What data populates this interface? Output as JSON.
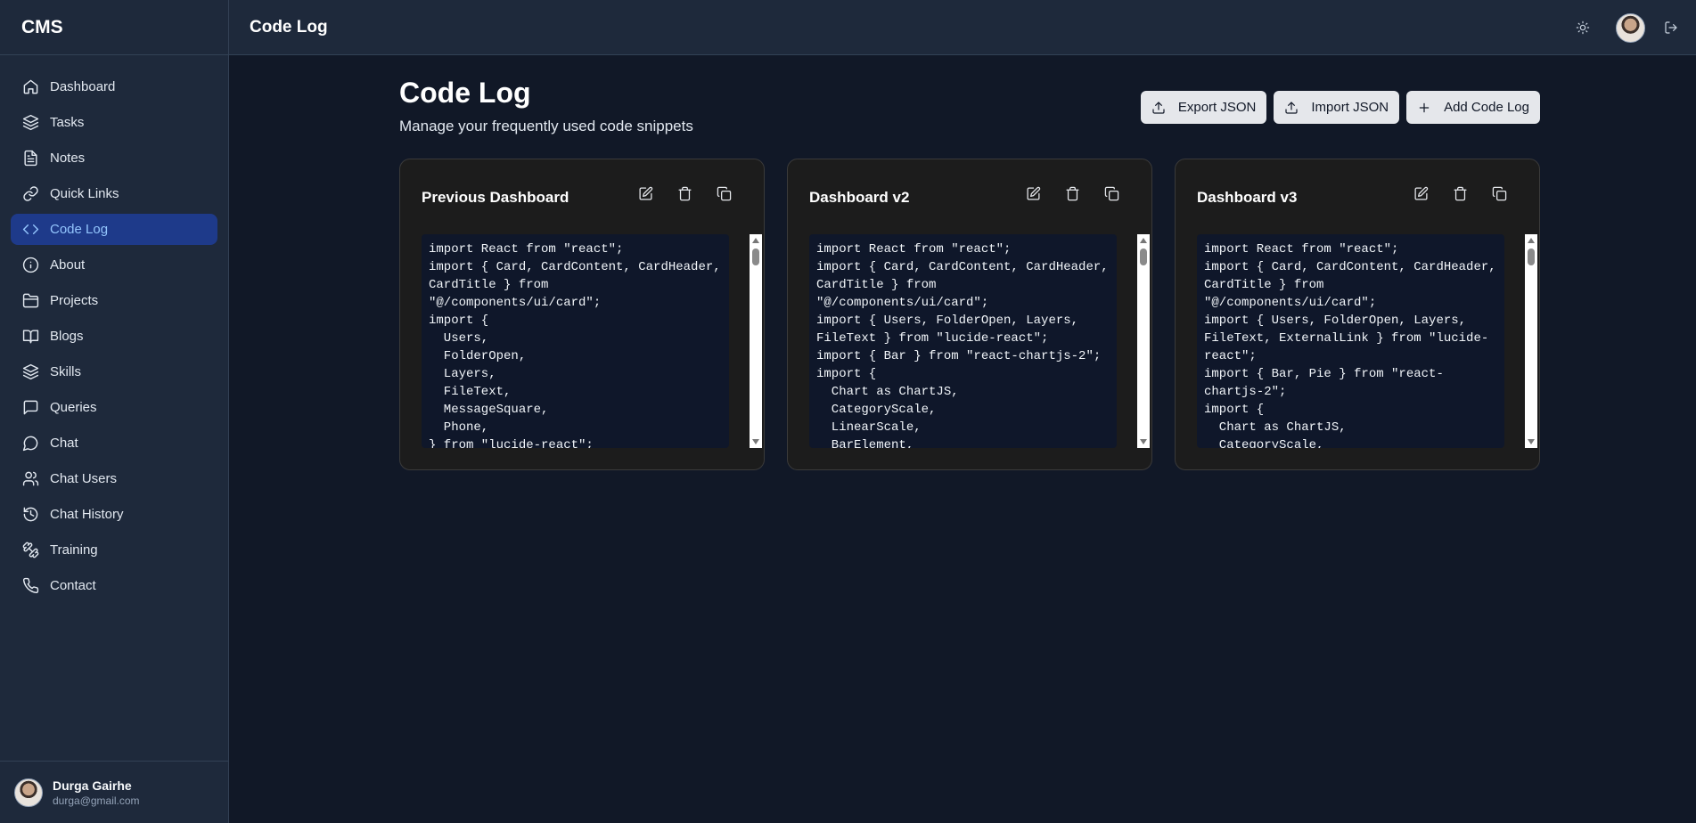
{
  "app": {
    "brand": "CMS"
  },
  "header": {
    "title": "Code Log"
  },
  "sidebar": {
    "items": [
      {
        "label": "Dashboard",
        "icon": "home-icon",
        "active": false
      },
      {
        "label": "Tasks",
        "icon": "layers-icon",
        "active": false
      },
      {
        "label": "Notes",
        "icon": "file-text-icon",
        "active": false
      },
      {
        "label": "Quick Links",
        "icon": "link-icon",
        "active": false
      },
      {
        "label": "Code Log",
        "icon": "code-icon",
        "active": true
      },
      {
        "label": "About",
        "icon": "info-icon",
        "active": false
      },
      {
        "label": "Projects",
        "icon": "folder-icon",
        "active": false
      },
      {
        "label": "Blogs",
        "icon": "book-open-icon",
        "active": false
      },
      {
        "label": "Skills",
        "icon": "layers-icon",
        "active": false
      },
      {
        "label": "Queries",
        "icon": "message-square-icon",
        "active": false
      },
      {
        "label": "Chat",
        "icon": "message-circle-icon",
        "active": false
      },
      {
        "label": "Chat Users",
        "icon": "users-icon",
        "active": false
      },
      {
        "label": "Chat History",
        "icon": "history-icon",
        "active": false
      },
      {
        "label": "Training",
        "icon": "dumbbell-icon",
        "active": false
      },
      {
        "label": "Contact",
        "icon": "phone-icon",
        "active": false
      }
    ],
    "user": {
      "name": "Durga Gairhe",
      "email": "durga@gmail.com"
    }
  },
  "main": {
    "title": "Code Log",
    "subtitle": "Manage your frequently used code snippets",
    "actions": {
      "export_label": "Export JSON",
      "import_label": "Import JSON",
      "add_label": "Add Code Log"
    },
    "cards": [
      {
        "title": "Previous Dashboard",
        "code": "import React from \"react\";\nimport { Card, CardContent, CardHeader,\nCardTitle } from\n\"@/components/ui/card\";\nimport {\n  Users,\n  FolderOpen,\n  Layers,\n  FileText,\n  MessageSquare,\n  Phone,\n} from \"lucide-react\";"
      },
      {
        "title": "Dashboard v2",
        "code": "import React from \"react\";\nimport { Card, CardContent, CardHeader,\nCardTitle } from\n\"@/components/ui/card\";\nimport { Users, FolderOpen, Layers,\nFileText } from \"lucide-react\";\nimport { Bar } from \"react-chartjs-2\";\nimport {\n  Chart as ChartJS,\n  CategoryScale,\n  LinearScale,\n  BarElement,"
      },
      {
        "title": "Dashboard v3",
        "code": "import React from \"react\";\nimport { Card, CardContent, CardHeader,\nCardTitle } from\n\"@/components/ui/card\";\nimport { Users, FolderOpen, Layers,\nFileText, ExternalLink } from \"lucide-\nreact\";\nimport { Bar, Pie } from \"react-\nchartjs-2\";\nimport {\n  Chart as ChartJS,\n  CategoryScale,"
      }
    ]
  },
  "colors": {
    "background": "#111827",
    "sidebar": "#1e293b",
    "active_item_bg": "#1e3a8a",
    "active_item_text": "#93c5fd",
    "card_bg": "#1c1c1c",
    "button_bg": "#e5e7eb"
  }
}
